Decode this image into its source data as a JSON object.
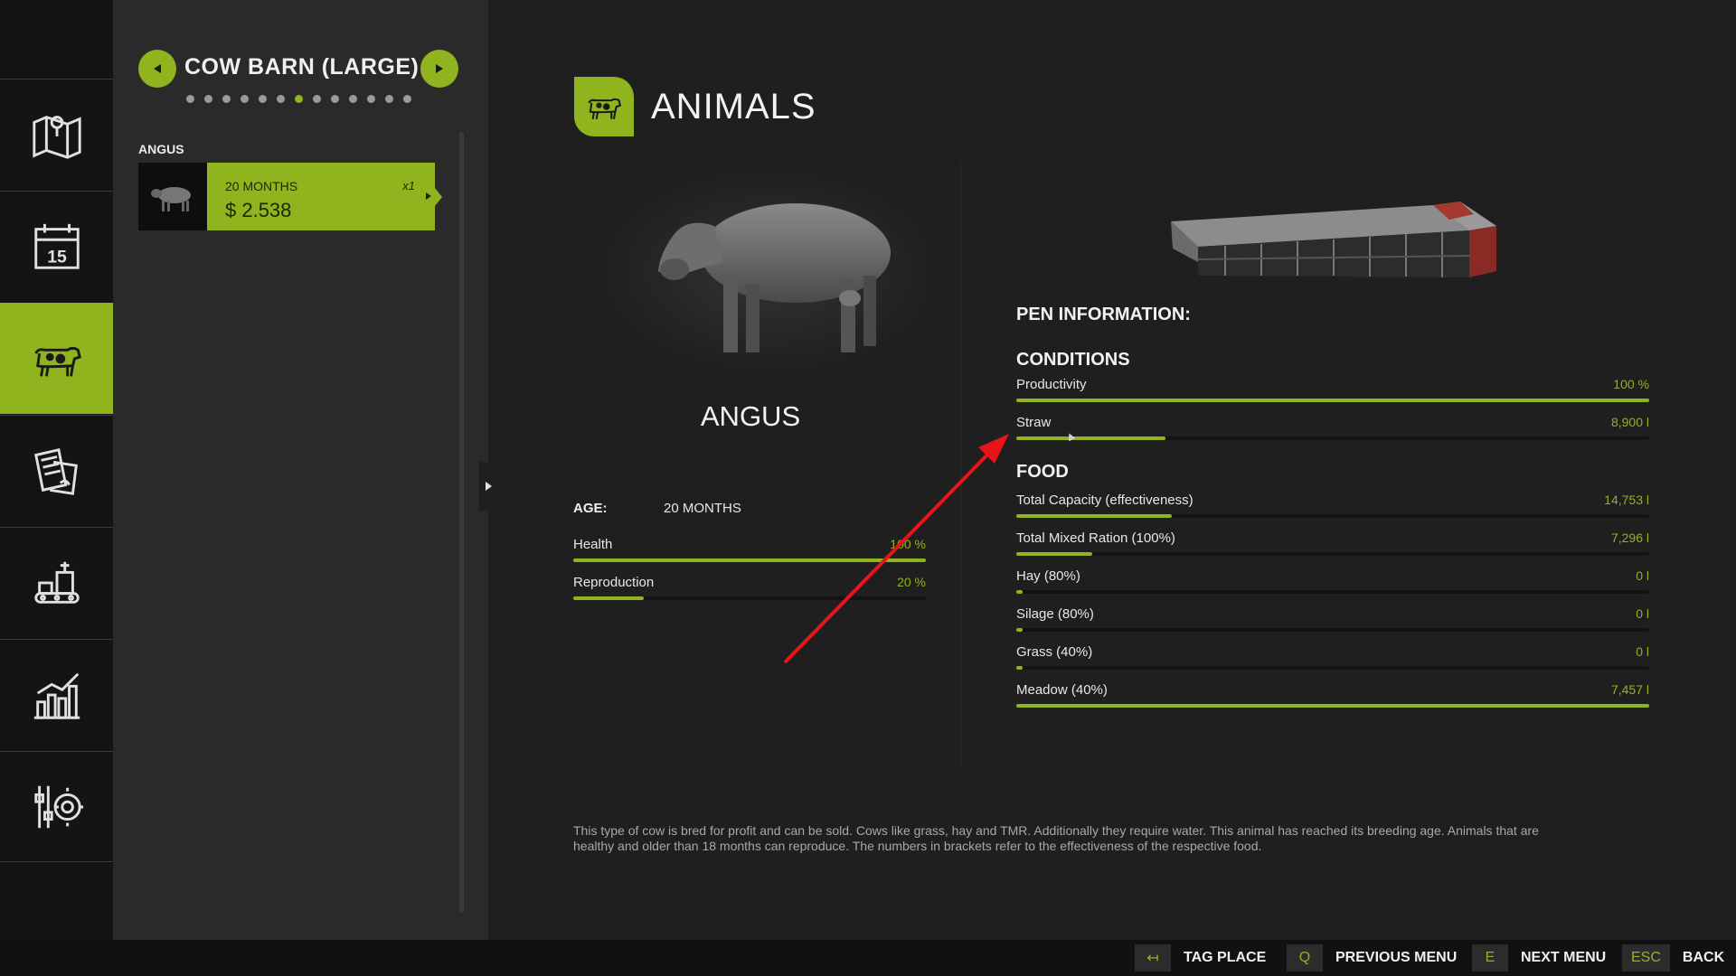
{
  "rail": {
    "items": [
      {
        "name": "map",
        "icon": "map-icon"
      },
      {
        "name": "calendar",
        "icon": "calendar-icon",
        "day": "15"
      },
      {
        "name": "animals",
        "icon": "cow-icon",
        "active": true
      },
      {
        "name": "contracts",
        "icon": "contracts-icon"
      },
      {
        "name": "production",
        "icon": "production-icon"
      },
      {
        "name": "statistics",
        "icon": "statistics-icon"
      },
      {
        "name": "settings",
        "icon": "settings-icon"
      }
    ]
  },
  "pen_list": {
    "title": "COW BARN (LARGE)",
    "page_dots": 13,
    "active_dot": 6,
    "group_label": "ANGUS",
    "card": {
      "age": "20 MONTHS",
      "price": "$ 2.538",
      "count": "x1"
    }
  },
  "main": {
    "section_title": "ANIMALS",
    "animal_name": "ANGUS",
    "age_label": "AGE:",
    "age_value": "20 MONTHS",
    "animal_stats": [
      {
        "label": "Health",
        "value": "100 %",
        "fraction": 1.0
      },
      {
        "label": "Reproduction",
        "value": "20 %",
        "fraction": 0.2
      }
    ],
    "pen_info_title": "PEN INFORMATION:",
    "conditions_title": "CONDITIONS",
    "conditions": [
      {
        "label": "Productivity",
        "value": "100 %",
        "fraction": 1.0
      },
      {
        "label": "Straw",
        "value": "8,900 l",
        "fraction": 0.235
      }
    ],
    "food_title": "FOOD",
    "food": [
      {
        "label": "Total Capacity (effectiveness)",
        "value": "14,753 l",
        "fraction": 0.245
      },
      {
        "label": "Total Mixed Ration (100%)",
        "value": "7,296 l",
        "fraction": 0.12
      },
      {
        "label": "Hay (80%)",
        "value": "0 l",
        "fraction": 0.01
      },
      {
        "label": "Silage (80%)",
        "value": "0 l",
        "fraction": 0.01
      },
      {
        "label": "Grass (40%)",
        "value": "0 l",
        "fraction": 0.01
      },
      {
        "label": "Meadow (40%)",
        "value": "7,457 l",
        "fraction": 1.0
      }
    ],
    "description": "This type of cow is bred for profit and can be sold. Cows like grass, hay and TMR. Additionally they require water. This animal has reached its breeding age. Animals that are healthy and older than 18 months can reproduce. The numbers in brackets refer to the effectiveness of the respective food."
  },
  "bottom_bar": {
    "hints": [
      {
        "key": "↤",
        "label": "TAG PLACE"
      },
      {
        "key": "Q",
        "label": "PREVIOUS MENU"
      },
      {
        "key": "E",
        "label": "NEXT MENU"
      },
      {
        "key": "ESC",
        "label": "BACK"
      }
    ]
  },
  "colors": {
    "accent": "#8fb41e",
    "background": "#1f1f1f",
    "rail": "#141414",
    "panel": "#2a2a2a",
    "annotation_arrow": "#e8141a"
  }
}
